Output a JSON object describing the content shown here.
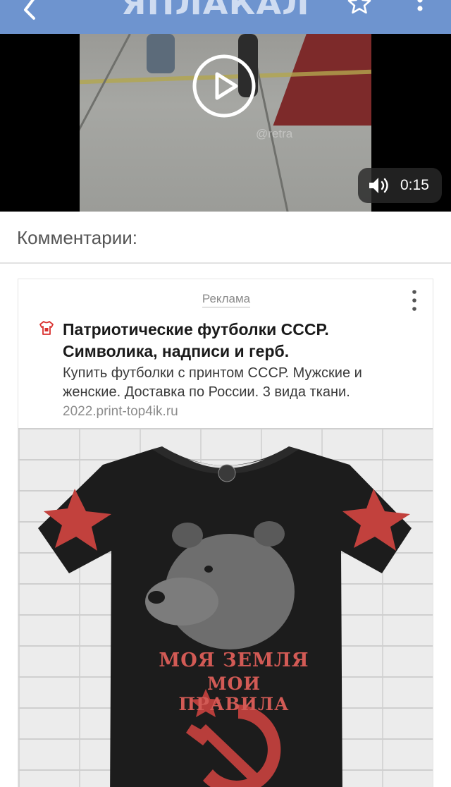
{
  "header": {
    "logo_text": "ЯПЛАКАЛ",
    "back_icon": "chevron-left-icon",
    "favorite_icon": "star-outline-icon",
    "menu_icon": "kebab-icon",
    "bar_color": "#6e94cf"
  },
  "video": {
    "watermark": "@retra",
    "duration": "0:15",
    "play_icon": "play-icon",
    "volume_icon": "speaker-icon"
  },
  "comments": {
    "title": "Комментарии:"
  },
  "ad": {
    "label": "Реклама",
    "headline": "Патриотические футболки СССР. Символика, надписи и герб.",
    "description": "Купить футболки с принтом СССР. Мужские и женские. Доставка по России. 3 вида ткани.",
    "url": "2022.print-top4ik.ru",
    "image": {
      "print_line1": "МОЯ ЗЕМЛЯ",
      "print_line2": "МОИ ПРАВИЛА"
    }
  }
}
